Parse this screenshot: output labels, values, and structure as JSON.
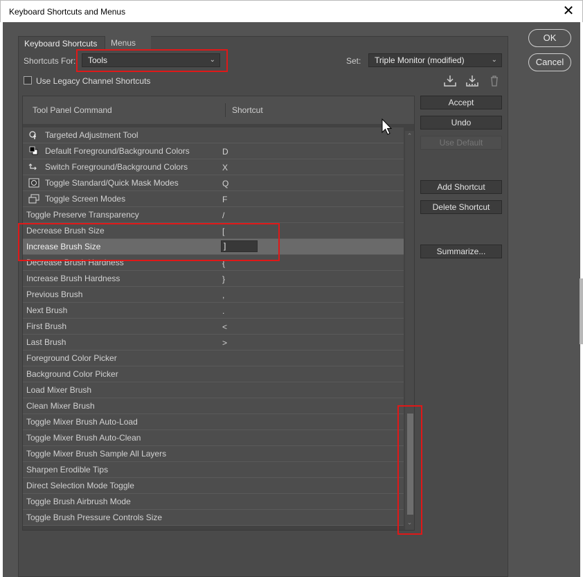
{
  "window": {
    "title": "Keyboard Shortcuts and Menus",
    "close_glyph": "✕"
  },
  "tabs": [
    "Keyboard Shortcuts",
    "Menus"
  ],
  "shortcuts_for": {
    "label": "Shortcuts For:",
    "value": "Tools"
  },
  "set": {
    "label": "Set:",
    "value": "Triple Monitor (modified)"
  },
  "legacy_checkbox": {
    "label": "Use Legacy Channel Shortcuts",
    "checked": false
  },
  "table": {
    "col_command": "Tool Panel Command",
    "col_shortcut": "Shortcut",
    "rows": [
      {
        "command": "Targeted Adjustment Tool",
        "shortcut": "",
        "icon": "targeted-adjustment-icon"
      },
      {
        "command": "Default Foreground/Background Colors",
        "shortcut": "D",
        "icon": "default-colors-icon"
      },
      {
        "command": "Switch Foreground/Background Colors",
        "shortcut": "X",
        "icon": "switch-colors-icon"
      },
      {
        "command": "Toggle Standard/Quick Mask Modes",
        "shortcut": "Q",
        "icon": "quick-mask-icon"
      },
      {
        "command": "Toggle Screen Modes",
        "shortcut": "F",
        "icon": "screen-mode-icon"
      },
      {
        "command": "Toggle Preserve Transparency",
        "shortcut": "/"
      },
      {
        "command": "Decrease Brush Size",
        "shortcut": "["
      },
      {
        "command": "Increase Brush Size",
        "shortcut": "]",
        "selected": true
      },
      {
        "command": "Decrease Brush Hardness",
        "shortcut": "{"
      },
      {
        "command": "Increase Brush Hardness",
        "shortcut": "}"
      },
      {
        "command": "Previous Brush",
        "shortcut": ","
      },
      {
        "command": "Next Brush",
        "shortcut": "."
      },
      {
        "command": "First Brush",
        "shortcut": "<"
      },
      {
        "command": "Last Brush",
        "shortcut": ">"
      },
      {
        "command": "Foreground Color Picker",
        "shortcut": ""
      },
      {
        "command": "Background Color Picker",
        "shortcut": ""
      },
      {
        "command": "Load Mixer Brush",
        "shortcut": ""
      },
      {
        "command": "Clean Mixer Brush",
        "shortcut": ""
      },
      {
        "command": "Toggle Mixer Brush Auto-Load",
        "shortcut": ""
      },
      {
        "command": "Toggle Mixer Brush Auto-Clean",
        "shortcut": ""
      },
      {
        "command": "Toggle Mixer Brush Sample All Layers",
        "shortcut": ""
      },
      {
        "command": "Sharpen Erodible Tips",
        "shortcut": ""
      },
      {
        "command": "Direct Selection Mode Toggle",
        "shortcut": ""
      },
      {
        "command": "Toggle Brush Airbrush Mode",
        "shortcut": ""
      },
      {
        "command": "Toggle Brush Pressure Controls Size",
        "shortcut": ""
      }
    ]
  },
  "buttons": {
    "ok": "OK",
    "cancel": "Cancel",
    "accept": "Accept",
    "undo": "Undo",
    "use_default": "Use Default",
    "add_shortcut": "Add Shortcut",
    "delete_shortcut": "Delete Shortcut",
    "summarize": "Summarize..."
  },
  "colors": {
    "dialog_bg": "#535353",
    "highlight": "#e01818",
    "selected_row": "#6a6a6a"
  }
}
